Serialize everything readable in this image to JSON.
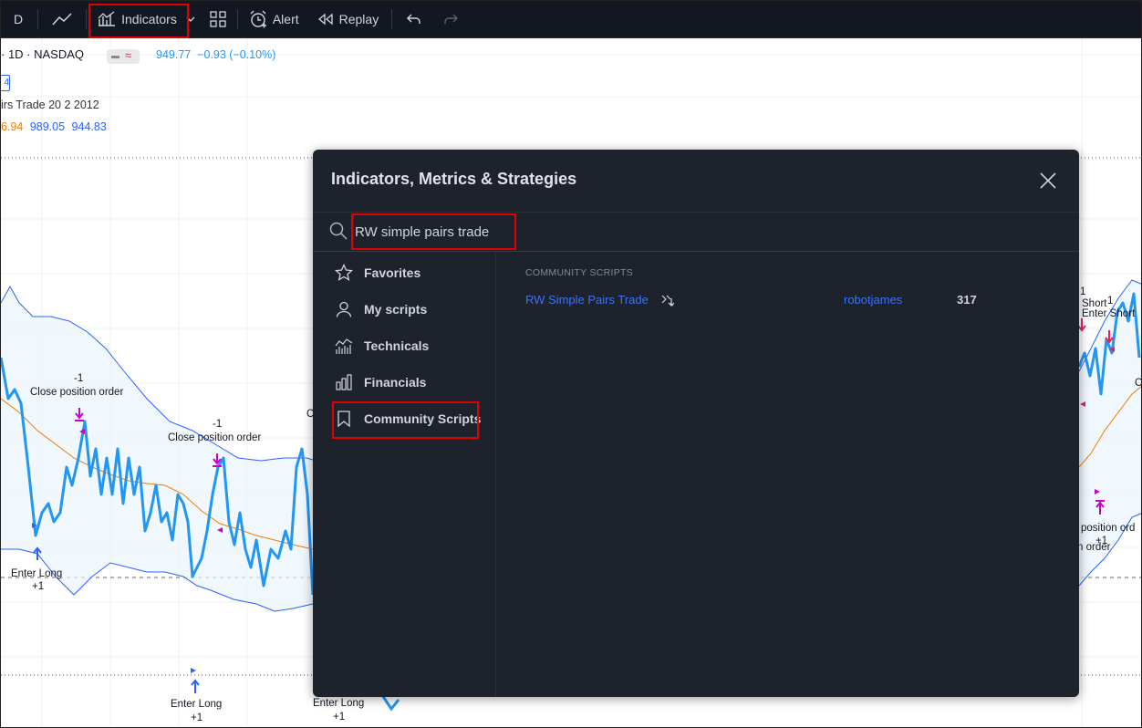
{
  "toolbar": {
    "interval": "D",
    "indicators_label": "Indicators",
    "alert_label": "Alert",
    "replay_label": "Replay"
  },
  "legend": {
    "symbol": "· 1D · NASDAQ",
    "price": "949.77",
    "change": "−0.93 (−0.10%)",
    "box": "4",
    "study_name": "irs Trade 20 2 2012",
    "study_val1": "6.94",
    "study_val2": "989.05",
    "study_val3": "944.83"
  },
  "annotations": {
    "a1_num": "-1",
    "a1_text": "Close position order",
    "a2_num": "-1",
    "a2_text": "Close position order",
    "a3_text": "C",
    "a4_text": "Enter Long",
    "a4_num": "+1",
    "a5_text": "Enter Long",
    "a5_num": "+1",
    "a6_text": "Enter Long",
    "a6_num": "+1",
    "r1_num": "1",
    "r1_text": "Short",
    "r1_num2": "1",
    "r2_text": "Enter Short",
    "r3_text": "C",
    "r4_text": "position ord",
    "r4_num": "+1",
    "r5_text": "n order"
  },
  "dialog": {
    "title": "Indicators, Metrics & Strategies",
    "search_value": "RW simple pairs trade",
    "sidebar": [
      {
        "label": "Favorites",
        "icon": "star-icon"
      },
      {
        "label": "My scripts",
        "icon": "user-icon"
      },
      {
        "label": "Technicals",
        "icon": "technicals-icon"
      },
      {
        "label": "Financials",
        "icon": "financials-icon"
      },
      {
        "label": "Community Scripts",
        "icon": "bookmark-icon"
      }
    ],
    "section_title": "COMMUNITY SCRIPTS",
    "results": [
      {
        "name": "RW Simple Pairs Trade",
        "author": "robotjames",
        "likes": "317"
      }
    ]
  },
  "colors": {
    "toolbar_bg": "#131722",
    "dialog_bg": "#1e222d",
    "accent_blue": "#3b74f2",
    "highlight_red": "#e00000",
    "series_blue": "#2196f3",
    "series_orange": "#f57c00",
    "marker_magenta": "#cc00cc"
  }
}
